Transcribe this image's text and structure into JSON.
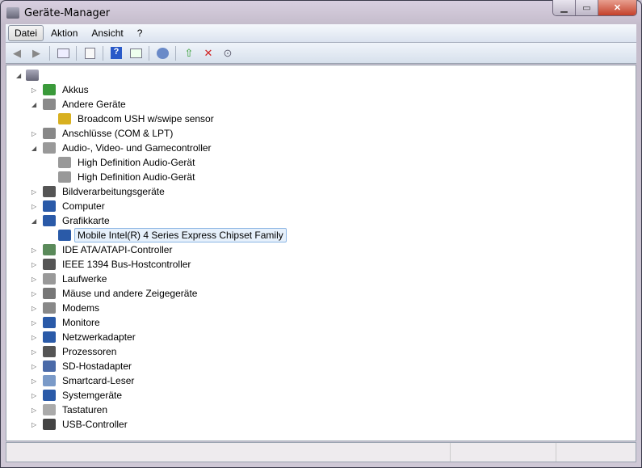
{
  "window": {
    "title": "Geräte-Manager"
  },
  "menu": [
    "Datei",
    "Aktion",
    "Ansicht",
    "?"
  ],
  "toolbar": [
    "back",
    "forward",
    "show-hide-console-tree",
    "properties",
    "help",
    "show-action-pane",
    "scan-hardware",
    "update-driver",
    "uninstall",
    "disable"
  ],
  "tree": {
    "root": "",
    "items": [
      {
        "label": "Akkus",
        "level": 1,
        "expanded": false,
        "icon": "battery-icon",
        "color": "#3a9a3a"
      },
      {
        "label": "Andere Geräte",
        "level": 1,
        "expanded": true,
        "icon": "unknown-device-icon",
        "color": "#8a8a8a"
      },
      {
        "label": "Broadcom USH w/swipe sensor",
        "level": 2,
        "icon": "warning-device-icon",
        "color": "#d8b020"
      },
      {
        "label": "Anschlüsse (COM & LPT)",
        "level": 1,
        "expanded": false,
        "icon": "port-icon",
        "color": "#888888"
      },
      {
        "label": "Audio-, Video- und Gamecontroller",
        "level": 1,
        "expanded": true,
        "icon": "speaker-icon",
        "color": "#999999"
      },
      {
        "label": "High Definition Audio-Gerät",
        "level": 2,
        "icon": "speaker-icon",
        "color": "#999999"
      },
      {
        "label": "High Definition Audio-Gerät",
        "level": 2,
        "icon": "speaker-icon",
        "color": "#999999"
      },
      {
        "label": "Bildverarbeitungsgeräte",
        "level": 1,
        "expanded": false,
        "icon": "camera-icon",
        "color": "#555555"
      },
      {
        "label": "Computer",
        "level": 1,
        "expanded": false,
        "icon": "computer-icon",
        "color": "#2a5aa8"
      },
      {
        "label": "Grafikkarte",
        "level": 1,
        "expanded": true,
        "icon": "display-adapter-icon",
        "color": "#2a5aa8"
      },
      {
        "label": "Mobile Intel(R) 4 Series Express Chipset Family",
        "level": 2,
        "icon": "display-adapter-icon",
        "color": "#2a5aa8",
        "selected": true
      },
      {
        "label": "IDE ATA/ATAPI-Controller",
        "level": 1,
        "expanded": false,
        "icon": "ide-icon",
        "color": "#5a8a5a"
      },
      {
        "label": "IEEE 1394 Bus-Hostcontroller",
        "level": 1,
        "expanded": false,
        "icon": "firewire-icon",
        "color": "#555555"
      },
      {
        "label": "Laufwerke",
        "level": 1,
        "expanded": false,
        "icon": "drive-icon",
        "color": "#999999"
      },
      {
        "label": "Mäuse und andere Zeigegeräte",
        "level": 1,
        "expanded": false,
        "icon": "mouse-icon",
        "color": "#777777"
      },
      {
        "label": "Modems",
        "level": 1,
        "expanded": false,
        "icon": "modem-icon",
        "color": "#888888"
      },
      {
        "label": "Monitore",
        "level": 1,
        "expanded": false,
        "icon": "monitor-icon",
        "color": "#2a5aa8"
      },
      {
        "label": "Netzwerkadapter",
        "level": 1,
        "expanded": false,
        "icon": "network-icon",
        "color": "#2a5aa8"
      },
      {
        "label": "Prozessoren",
        "level": 1,
        "expanded": false,
        "icon": "cpu-icon",
        "color": "#555555"
      },
      {
        "label": "SD-Hostadapter",
        "level": 1,
        "expanded": false,
        "icon": "sd-icon",
        "color": "#4a6aa8"
      },
      {
        "label": "Smartcard-Leser",
        "level": 1,
        "expanded": false,
        "icon": "smartcard-icon",
        "color": "#7a9ac8"
      },
      {
        "label": "Systemgeräte",
        "level": 1,
        "expanded": false,
        "icon": "system-device-icon",
        "color": "#2a5aa8"
      },
      {
        "label": "Tastaturen",
        "level": 1,
        "expanded": false,
        "icon": "keyboard-icon",
        "color": "#aaaaaa"
      },
      {
        "label": "USB-Controller",
        "level": 1,
        "expanded": false,
        "icon": "usb-icon",
        "color": "#444444"
      }
    ]
  }
}
